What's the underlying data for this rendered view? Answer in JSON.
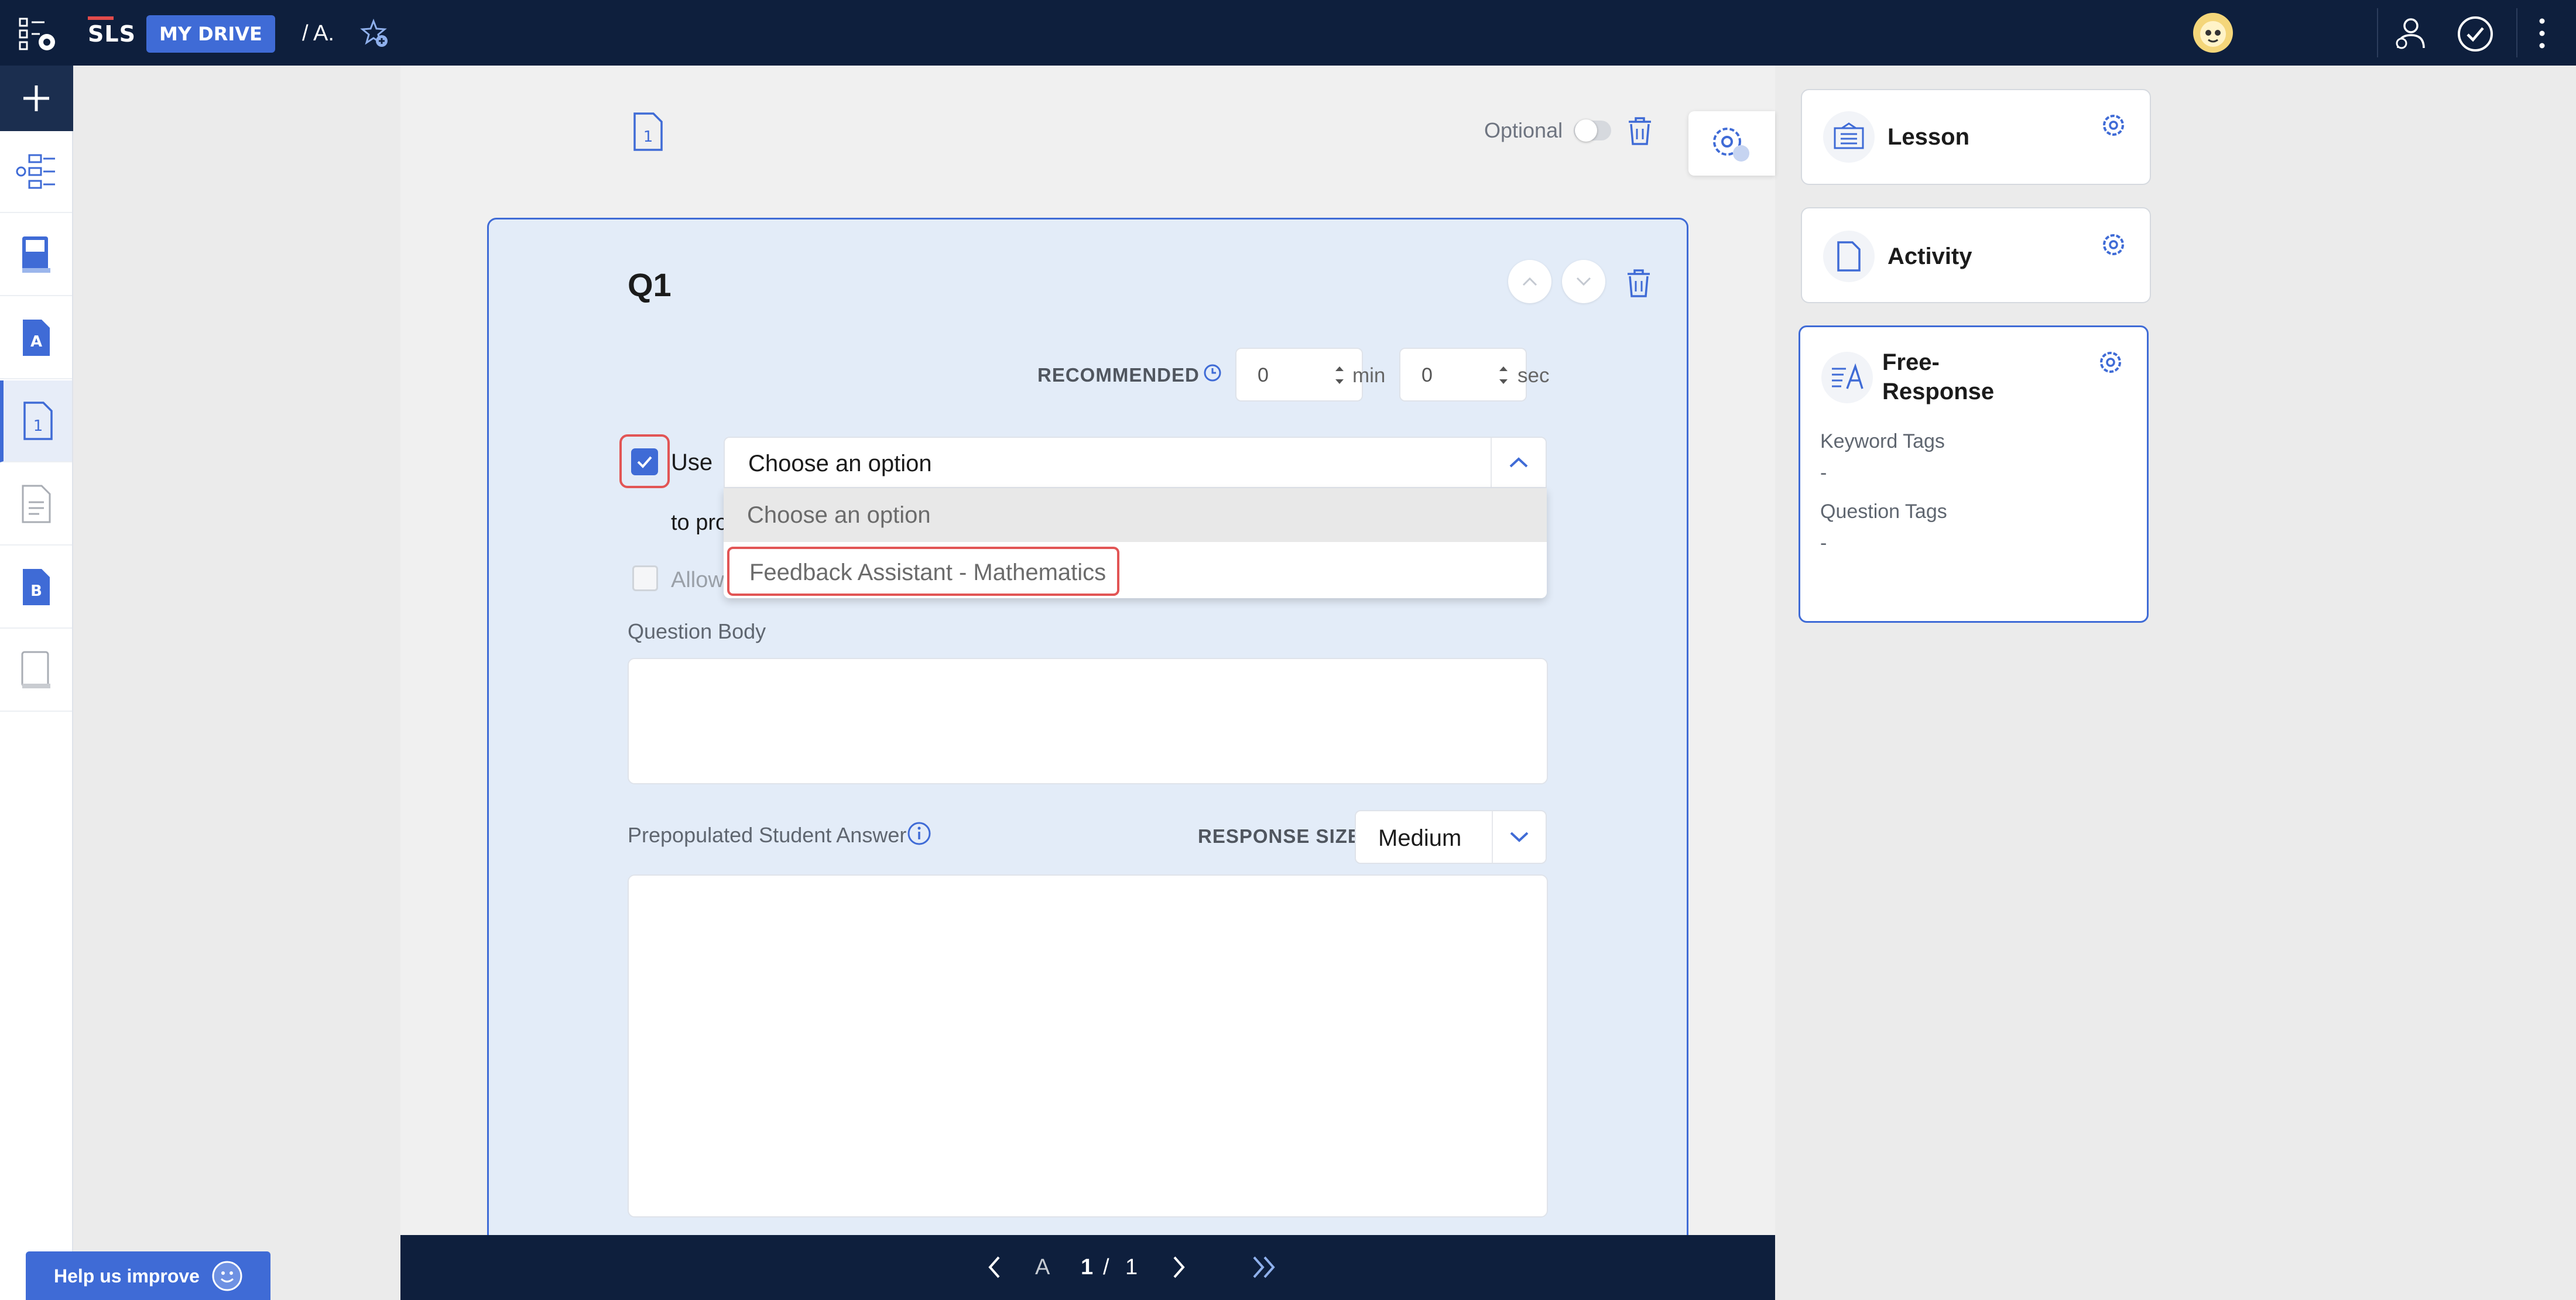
{
  "topbar": {
    "brand": "SLS",
    "my_drive": "MY DRIVE",
    "breadcrumb": "/  A."
  },
  "editor": {
    "optional_label": "Optional",
    "question_number": "Q1",
    "recommended_label": "RECOMMENDED",
    "min_value": "0",
    "min_unit": "min",
    "sec_value": "0",
    "sec_unit": "sec",
    "use_label": "Use",
    "to_provide_label": "to pro",
    "allow_label": "Allow",
    "assistant_select": {
      "value": "Choose an option",
      "options": [
        "Choose an option",
        "Feedback Assistant - Mathematics"
      ]
    },
    "question_body_label": "Question Body",
    "prepopulated_label": "Prepopulated Student Answer",
    "response_size_label": "RESPONSE SIZE",
    "response_size_value": "Medium"
  },
  "navigator": {
    "section": "A",
    "page_current": "1",
    "page_sep": "/",
    "page_total": "1"
  },
  "help": {
    "label": "Help us improve"
  },
  "right_panel": {
    "lesson": "Lesson",
    "activity": "Activity",
    "free_response_line1": "Free-",
    "free_response_line2": "Response",
    "keyword_tags_label": "Keyword Tags",
    "keyword_tags_value": "-",
    "question_tags_label": "Question Tags",
    "question_tags_value": "-"
  },
  "colors": {
    "navy": "#0e1f3d",
    "accent": "#3f6bd6",
    "highlight_red": "#e25555",
    "card_bg": "#e3ecf8"
  }
}
